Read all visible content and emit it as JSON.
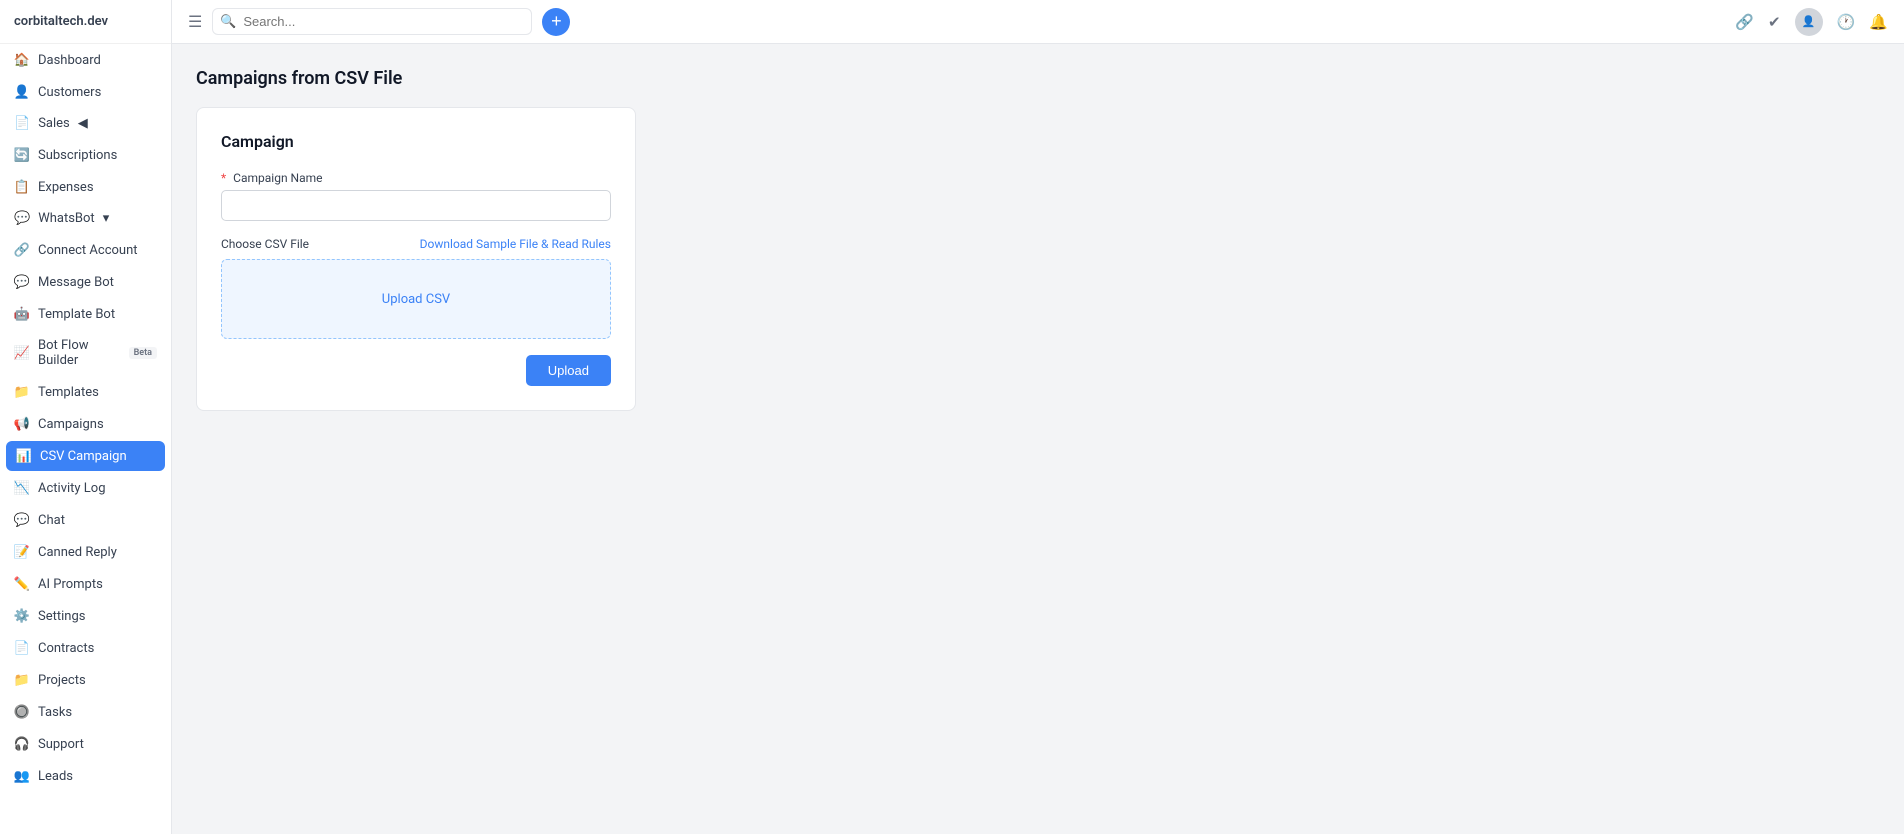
{
  "site": {
    "domain": "corbitaltech.dev"
  },
  "topbar": {
    "search_placeholder": "Search...",
    "add_label": "+"
  },
  "sidebar": {
    "nav_items": [
      {
        "id": "dashboard",
        "label": "Dashboard",
        "icon": "🏠",
        "active": false
      },
      {
        "id": "customers",
        "label": "Customers",
        "icon": "👤",
        "active": false
      },
      {
        "id": "sales",
        "label": "Sales",
        "icon": "📄",
        "active": false,
        "has_chevron": true
      },
      {
        "id": "subscriptions",
        "label": "Subscriptions",
        "icon": "🔄",
        "active": false
      },
      {
        "id": "expenses",
        "label": "Expenses",
        "icon": "📋",
        "active": false
      },
      {
        "id": "whatsbot",
        "label": "WhatsBot",
        "icon": "💬",
        "active": false,
        "has_chevron": true,
        "expanded": true
      }
    ],
    "whatsbot_subitems": [
      {
        "id": "connect-account",
        "label": "Connect Account",
        "icon": "🔗"
      },
      {
        "id": "message-bot",
        "label": "Message Bot",
        "icon": "💬"
      },
      {
        "id": "template-bot",
        "label": "Template Bot",
        "icon": "🤖"
      },
      {
        "id": "bot-flow-builder",
        "label": "Bot Flow Builder",
        "icon": "📈",
        "badge": "Beta"
      },
      {
        "id": "templates",
        "label": "Templates",
        "icon": "📁"
      },
      {
        "id": "campaigns",
        "label": "Campaigns",
        "icon": "📢"
      },
      {
        "id": "csv-campaign",
        "label": "CSV Campaign",
        "icon": "📊",
        "active": true
      },
      {
        "id": "activity-log",
        "label": "Activity Log",
        "icon": "📉"
      },
      {
        "id": "chat",
        "label": "Chat",
        "icon": "💬"
      },
      {
        "id": "canned-reply",
        "label": "Canned Reply",
        "icon": "📝"
      },
      {
        "id": "ai-prompts",
        "label": "AI Prompts",
        "icon": "✏️"
      },
      {
        "id": "settings",
        "label": "Settings",
        "icon": "⚙️"
      }
    ],
    "bottom_items": [
      {
        "id": "contracts",
        "label": "Contracts",
        "icon": "📄"
      },
      {
        "id": "projects",
        "label": "Projects",
        "icon": "📁"
      },
      {
        "id": "tasks",
        "label": "Tasks",
        "icon": "🔘"
      },
      {
        "id": "support",
        "label": "Support",
        "icon": "🎧"
      },
      {
        "id": "leads",
        "label": "Leads",
        "icon": "👥"
      }
    ]
  },
  "page": {
    "title": "Campaigns from CSV File",
    "card_title": "Campaign",
    "form": {
      "campaign_name_label": "Campaign Name",
      "campaign_name_required": "*",
      "campaign_name_placeholder": "",
      "csv_file_label": "Choose CSV File",
      "csv_download_link": "Download Sample File & Read Rules",
      "upload_csv_label": "Upload CSV",
      "upload_btn_label": "Upload"
    }
  }
}
